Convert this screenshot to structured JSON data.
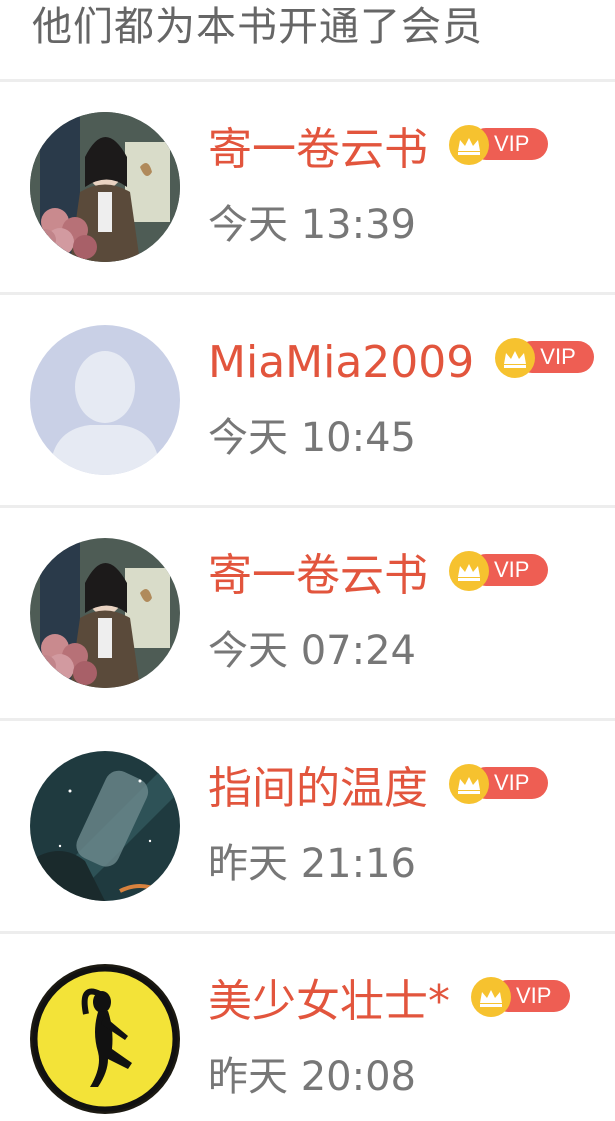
{
  "header": {
    "title": "他们都为本书开通了会员"
  },
  "badge": {
    "label": "VIP",
    "icon": "crown-icon",
    "color": "#ee5e53",
    "crown_color": "#f6c22f"
  },
  "name_color": "#e2553d",
  "members": [
    {
      "name": "寄一卷云书",
      "time": "今天 13:39",
      "avatar": "portrait-photo"
    },
    {
      "name": "MiaMia2009",
      "time": "今天 10:45",
      "avatar": "default-avatar-silhouette"
    },
    {
      "name": "寄一卷云书",
      "time": "今天 07:24",
      "avatar": "portrait-photo"
    },
    {
      "name": "指间的温度",
      "time": "昨天 21:16",
      "avatar": "bottle-starry-sky"
    },
    {
      "name": "美少女壮士*",
      "time": "昨天 20:08",
      "avatar": "dancer-silhouette-yellow"
    }
  ]
}
